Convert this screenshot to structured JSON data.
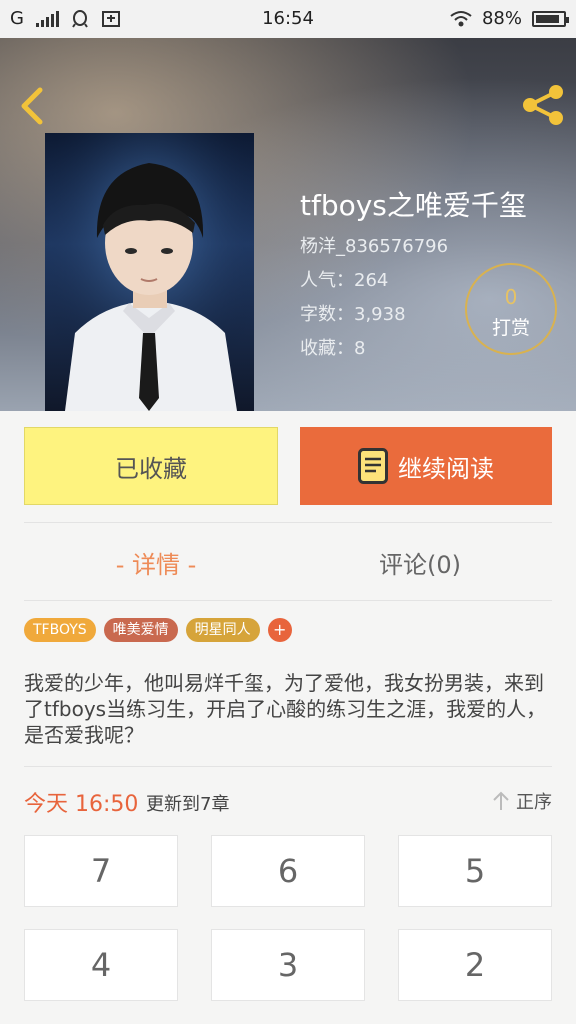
{
  "status_bar": {
    "carrier": "G",
    "time": "16:54",
    "battery": "88%",
    "battery_level": 0.88
  },
  "header": {
    "back_icon": "chevron-left-icon",
    "share_icon": "share-icon"
  },
  "book": {
    "title": "tfboys之唯爱千玺",
    "author": "杨洋_836576796",
    "popularity": "人气：264",
    "word_count": "字数：3,938",
    "favorites": "收藏：8"
  },
  "reward": {
    "count": "0",
    "label": "打赏"
  },
  "actions": {
    "favorited_label": "已收藏",
    "continue_label": "继续阅读"
  },
  "tabs": {
    "detail": "- 详情 -",
    "comments": "评论(0)"
  },
  "tags": [
    {
      "label": "TFBOYS",
      "color": "#f0a93b"
    },
    {
      "label": "唯美爱情",
      "color": "#c9694f"
    },
    {
      "label": "明星同人",
      "color": "#d6a43a"
    }
  ],
  "tag_add": "+",
  "description": "我爱的少年，他叫易烊千玺，为了爱他，我女扮男装，来到了tfboys当练习生，开启了心酸的练习生之涯，我爱的人，是否爱我呢？",
  "updates": {
    "time": "今天 16:50",
    "text": "更新到7章",
    "order_label": "正序"
  },
  "chapters": [
    "7",
    "6",
    "5",
    "4",
    "3",
    "2"
  ],
  "colors": {
    "accent_orange": "#ea6b3c",
    "favorite_yellow": "#fef37f",
    "gold": "#d9b24f"
  }
}
